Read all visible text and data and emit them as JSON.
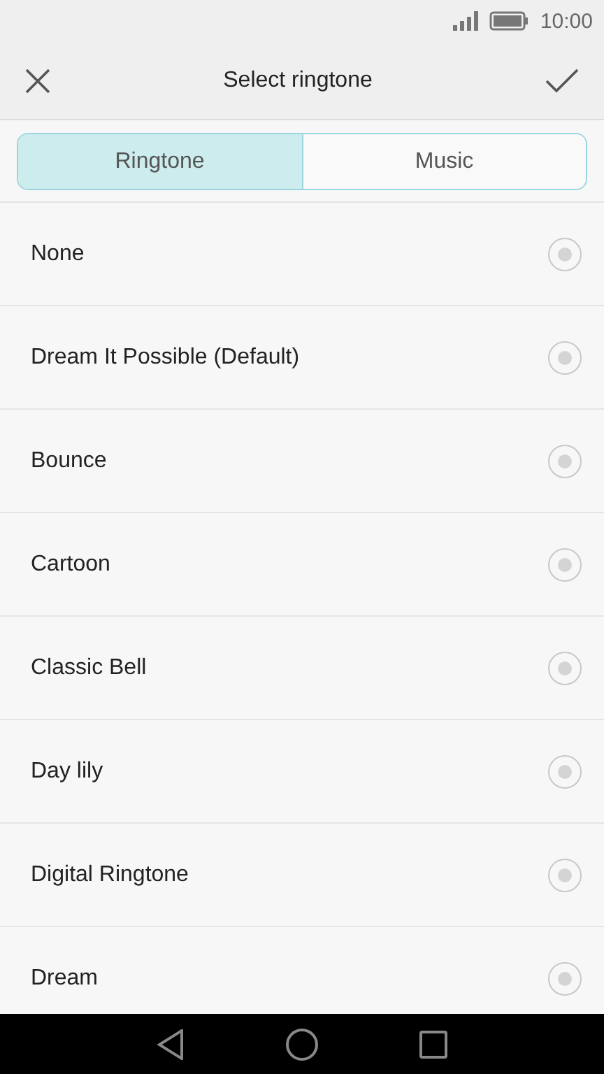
{
  "status_bar": {
    "time": "10:00"
  },
  "header": {
    "title": "Select ringtone"
  },
  "tabs": [
    {
      "label": "Ringtone",
      "selected": true
    },
    {
      "label": "Music",
      "selected": false
    }
  ],
  "ringtones": [
    {
      "name": "None",
      "selected": false
    },
    {
      "name": "Dream It Possible (Default)",
      "selected": false
    },
    {
      "name": "Bounce",
      "selected": false
    },
    {
      "name": "Cartoon",
      "selected": false
    },
    {
      "name": "Classic Bell",
      "selected": false
    },
    {
      "name": "Day lily",
      "selected": false
    },
    {
      "name": "Digital Ringtone",
      "selected": false
    },
    {
      "name": "Dream",
      "selected": false
    }
  ]
}
